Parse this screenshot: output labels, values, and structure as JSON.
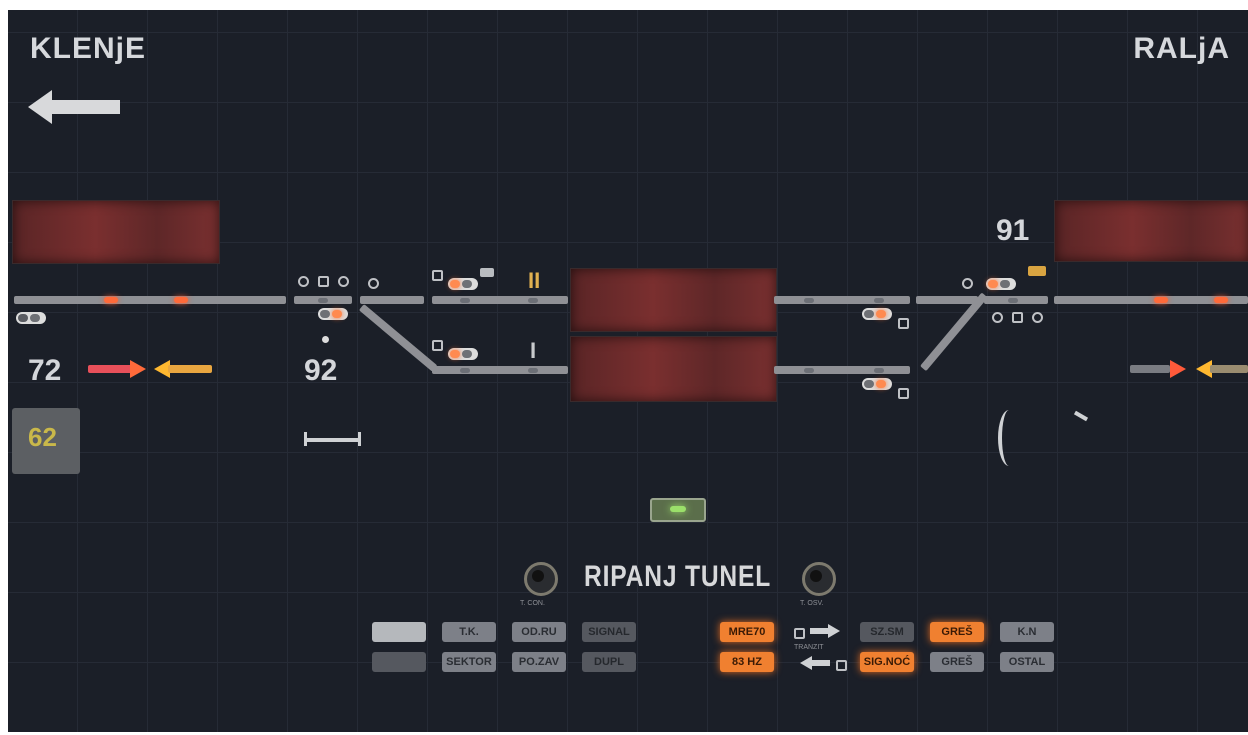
{
  "stations": {
    "left": "KLENjE",
    "right": "RALjA"
  },
  "block_numbers": {
    "n72": "72",
    "n92": "92",
    "n91": "91",
    "n62": "62"
  },
  "tracks": {
    "t2": "II",
    "t1": "I"
  },
  "panel_title": "RIPANJ TUNEL",
  "knobs": {
    "left_label": "T. CON.",
    "right_label": "T. OSV."
  },
  "tranzit_label": "TRANZIT",
  "buttons": {
    "row1": [
      "",
      "T.K.",
      "OD.RU",
      "SIGNAL",
      "MRE70",
      "",
      "SZ.SM",
      "GREŠ",
      "K.N"
    ],
    "row2": [
      "",
      "SEKTOR",
      "PO.ZAV",
      "DUPL",
      "83 HZ",
      "",
      "SIG.NOĆ",
      "GREŠ",
      "OSTAL"
    ]
  },
  "colors": {
    "lamp_red": "#ff6a3a",
    "lamp_amber": "#f08030",
    "green_ind": "#9be06a",
    "panel": "#1b1f28"
  },
  "icons": {
    "direction": "arrow-left-icon"
  }
}
